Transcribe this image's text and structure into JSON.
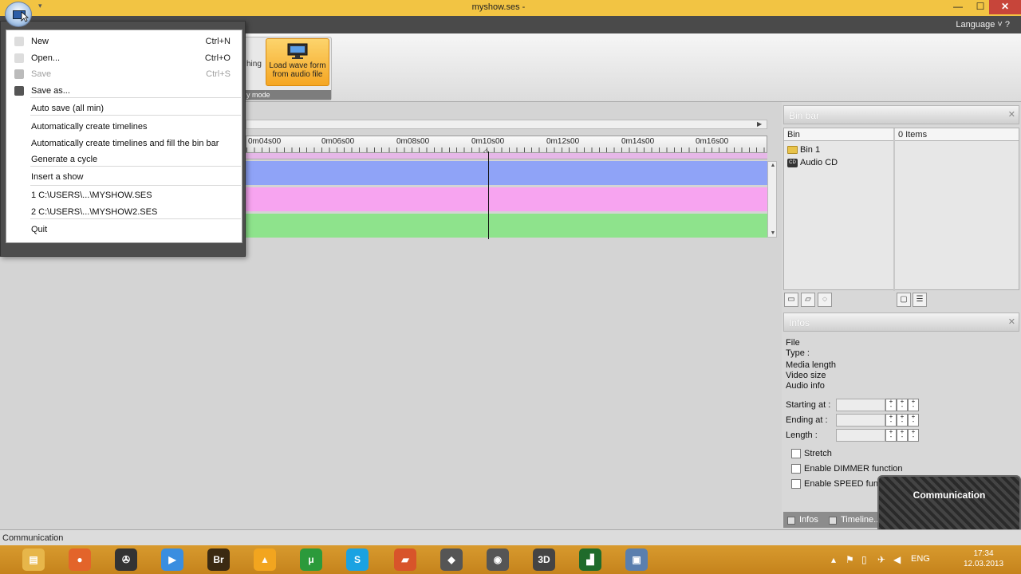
{
  "window": {
    "title": "myshow.ses -",
    "qa_glyph": "▾",
    "min": "—",
    "max": "☐",
    "close": "✕"
  },
  "ribbon": {
    "language_label": "Language",
    "language_chevron": "˅ ?",
    "partial_label": "hing",
    "load_wave_line1": "Load wave form",
    "load_wave_line2": "from audio file",
    "group_caption": "y mode"
  },
  "file_menu": {
    "items": [
      {
        "label": "New",
        "shortcut": "Ctrl+N",
        "enabled": true
      },
      {
        "label": "Open...",
        "shortcut": "Ctrl+O",
        "enabled": true
      },
      {
        "label": "Save",
        "shortcut": "Ctrl+S",
        "enabled": false
      },
      {
        "label": "Save as...",
        "shortcut": "",
        "enabled": true
      },
      {
        "label": "Auto save (all min)",
        "shortcut": "",
        "enabled": true
      },
      {
        "label": "Automatically create timelines",
        "shortcut": "",
        "enabled": true
      },
      {
        "label": "Automatically create timelines and fill the bin bar",
        "shortcut": "",
        "enabled": true
      },
      {
        "label": "Generate a cycle",
        "shortcut": "",
        "enabled": true
      },
      {
        "label": "Insert a show",
        "shortcut": "",
        "enabled": true
      },
      {
        "label": "1 C:\\USERS\\...\\MYSHOW.SES",
        "shortcut": "",
        "enabled": true
      },
      {
        "label": "2 C:\\USERS\\...\\MYSHOW2.SES",
        "shortcut": "",
        "enabled": true
      },
      {
        "label": "Quit",
        "shortcut": "",
        "enabled": true
      }
    ]
  },
  "timeline": {
    "ruler_labels": [
      "0m04s00",
      "0m06s00",
      "0m08s00",
      "0m10s00",
      "0m12s00",
      "0m14s00",
      "0m16s00"
    ],
    "scroll_right": "▶",
    "scroll_up": "▲",
    "scroll_down": "▼",
    "track_colors": [
      "#8fa3f7",
      "#f7a4f0",
      "#8ee38c"
    ]
  },
  "bin_bar": {
    "title": "Bin bar",
    "close": "✕",
    "col_bin": "Bin",
    "col_items": "0 Items",
    "items": [
      {
        "label": "Bin 1",
        "icon": "folder-icon"
      },
      {
        "label": "Audio CD",
        "icon": "cd-icon"
      }
    ]
  },
  "infos": {
    "title": "Infos",
    "close": "✕",
    "file_label": "File",
    "type_label": "Type :",
    "media_length_label": "Media length",
    "video_size_label": "Video size",
    "audio_info_label": "Audio info",
    "starting_label": "Starting at :",
    "ending_label": "Ending at :",
    "length_label": "Length :",
    "stretch_label": "Stretch",
    "dimmer_label": "Enable DIMMER function",
    "speed_label": "Enable SPEED function",
    "tab_infos": "Infos",
    "tab_timeline": "Timeline..."
  },
  "overlay": {
    "text": "Communication"
  },
  "status": {
    "text": "Communication"
  },
  "taskbar": {
    "apps": [
      {
        "name": "file-explorer",
        "glyph": "▤",
        "color": "#e7b64a"
      },
      {
        "name": "firefox",
        "glyph": "●",
        "color": "#e3642a"
      },
      {
        "name": "media-reel",
        "glyph": "✇",
        "color": "#333333"
      },
      {
        "name": "video-player",
        "glyph": "▶",
        "color": "#3a8ee0"
      },
      {
        "name": "adobe-bridge",
        "glyph": "Br",
        "color": "#3b2a12"
      },
      {
        "name": "aimp",
        "glyph": "▲",
        "color": "#f2a51f"
      },
      {
        "name": "utorrent",
        "glyph": "μ",
        "color": "#2b9a3b"
      },
      {
        "name": "skype",
        "glyph": "S",
        "color": "#1aa2e2"
      },
      {
        "name": "app-orange",
        "glyph": "▰",
        "color": "#d8542a"
      },
      {
        "name": "video-editor",
        "glyph": "◆",
        "color": "#555555"
      },
      {
        "name": "recorder",
        "glyph": "◉",
        "color": "#555555"
      },
      {
        "name": "3d-app",
        "glyph": "3D",
        "color": "#444444"
      },
      {
        "name": "stats-app",
        "glyph": "▟",
        "color": "#1f6b2b"
      },
      {
        "name": "show-app",
        "glyph": "▣",
        "color": "#5a7fae"
      }
    ],
    "lang": "ENG",
    "time": "17:34",
    "date": "12.03.2013"
  }
}
